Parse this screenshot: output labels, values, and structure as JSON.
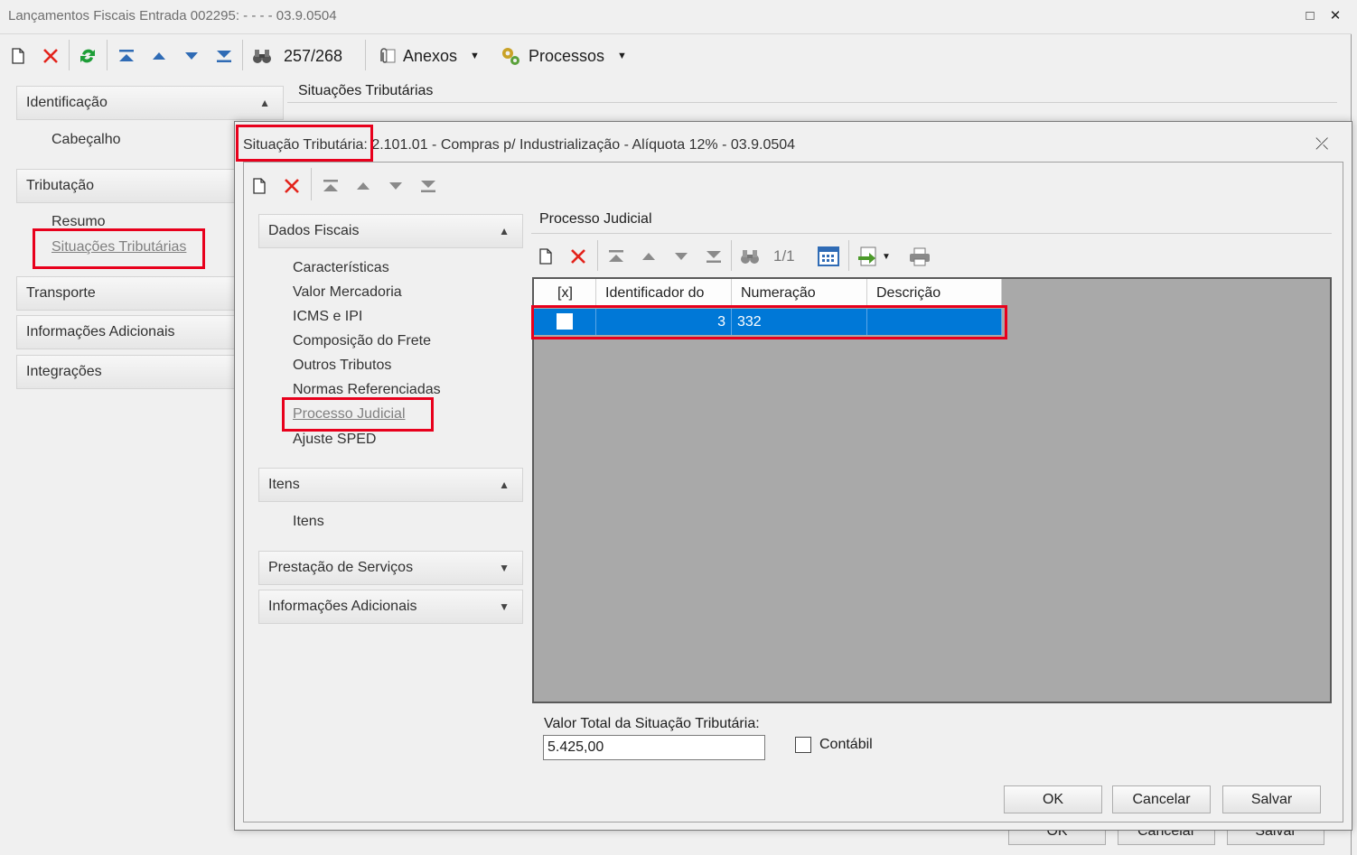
{
  "window": {
    "title": "Lançamentos Fiscais Entrada 002295: - - - - 03.9.0504",
    "controls": {
      "maximize": "□",
      "close": "✕"
    }
  },
  "toolbar": {
    "record_position": "257/268",
    "attachments_label": "Anexos",
    "processes_label": "Processos"
  },
  "left_nav": {
    "sections": [
      {
        "label": "Identificação",
        "items": [
          "Cabeçalho"
        ]
      },
      {
        "label": "Tributação",
        "items": [
          "Resumo",
          "Situações Tributárias"
        ]
      },
      {
        "label": "Transporte"
      },
      {
        "label": "Informações Adicionais"
      },
      {
        "label": "Integrações"
      }
    ],
    "selected": "Situações Tributárias"
  },
  "background_tab": {
    "label": "Situações Tributárias",
    "buttons": [
      "OK",
      "Cancelar",
      "Salvar"
    ]
  },
  "dialog": {
    "title_prefix": "Situação Tributária:",
    "title_rest": "2.101.01 - Compras p/ Industrialização - Alíquota 12% - 03.9.0504",
    "close_icon": "⤫",
    "nav": {
      "dados_fiscais": {
        "label": "Dados Fiscais",
        "items": [
          "Características",
          "Valor Mercadoria",
          "ICMS e IPI",
          "Composição do Frete",
          "Outros Tributos",
          "Normas Referenciadas",
          "Processo Judicial",
          "Ajuste SPED"
        ]
      },
      "itens": {
        "label": "Itens",
        "items": [
          "Itens"
        ]
      },
      "prestacao": {
        "label": "Prestação de Serviços"
      },
      "info_adicionais": {
        "label": "Informações Adicionais"
      }
    },
    "panel_title": "Processo Judicial",
    "grid_toolbar": {
      "record_position": "1/1"
    },
    "grid": {
      "columns": [
        "[x]",
        "Identificador do",
        "Numeração",
        "Descrição"
      ],
      "rows": [
        {
          "checked": false,
          "identificador": "3",
          "numeracao": "332",
          "descricao": ""
        }
      ]
    },
    "valor_total_label": "Valor Total da Situação Tributária:",
    "valor_total_value": "5.425,00",
    "contabil_label": "Contábil",
    "buttons": {
      "ok": "OK",
      "cancel": "Cancelar",
      "save": "Salvar"
    }
  },
  "colors": {
    "selection": "#0078d7",
    "highlight_box": "#e8001c",
    "grid_background": "#a9a9a9"
  }
}
